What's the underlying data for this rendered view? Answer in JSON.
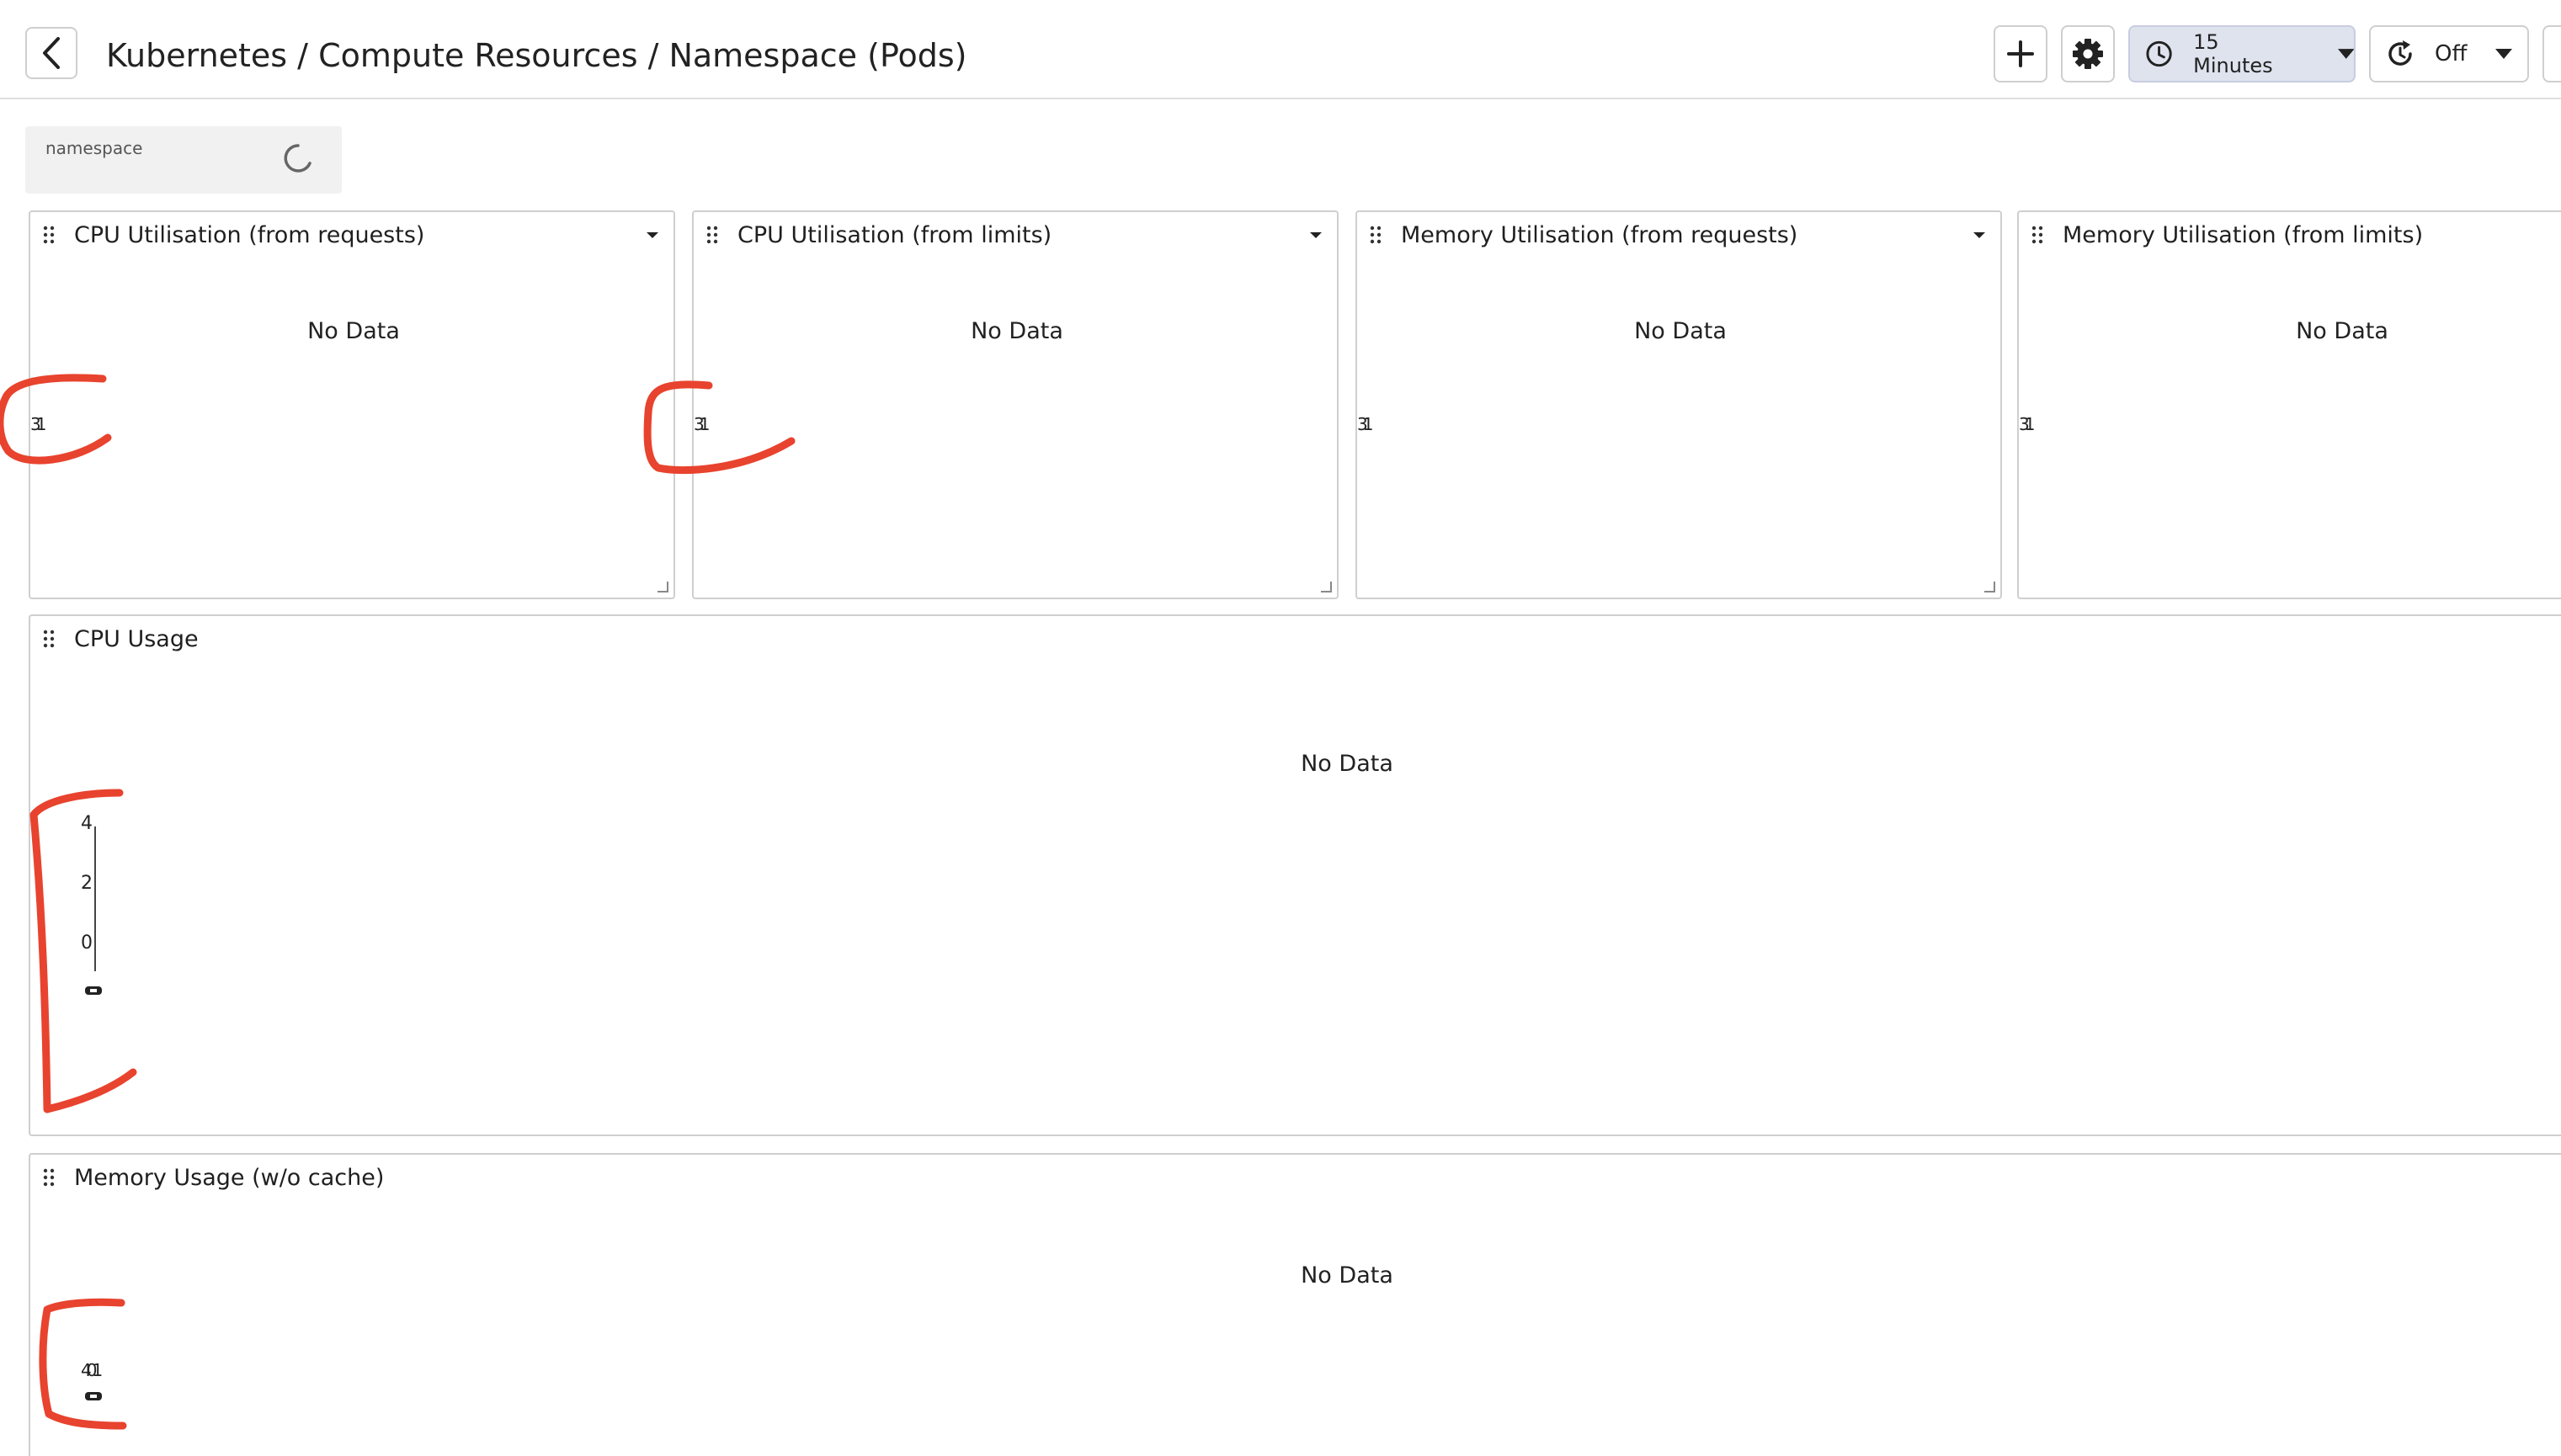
{
  "header": {
    "title": "Kubernetes / Compute Resources / Namespace (Pods)",
    "back_icon": "chevron-left-icon",
    "add_icon": "plus-icon",
    "settings_icon": "gear-icon",
    "time_range": "15 Minutes",
    "refresh_interval": "Off"
  },
  "variables": {
    "namespace_label": "namespace"
  },
  "panels": {
    "cpu_requests": {
      "title": "CPU Utilisation (from requests)",
      "message": "No Data",
      "glyph": "31"
    },
    "cpu_limits": {
      "title": "CPU Utilisation (from limits)",
      "message": "No Data",
      "glyph": "31"
    },
    "mem_requests": {
      "title": "Memory Utilisation (from requests)",
      "message": "No Data",
      "glyph": "31"
    },
    "mem_limits": {
      "title": "Memory Utilisation (from limits)",
      "message": "No Data",
      "glyph": "31"
    },
    "cpu_usage": {
      "title": "CPU Usage",
      "message": "No Data",
      "y_ticks": [
        "4",
        "2",
        "0"
      ]
    },
    "memory_usage": {
      "title": "Memory Usage (w/o cache)",
      "message": "No Data",
      "glyph": "401"
    }
  },
  "colors": {
    "annotation": "#e8432e",
    "time_button_bg": "#dfe3ee",
    "border": "#cfcfcf"
  }
}
